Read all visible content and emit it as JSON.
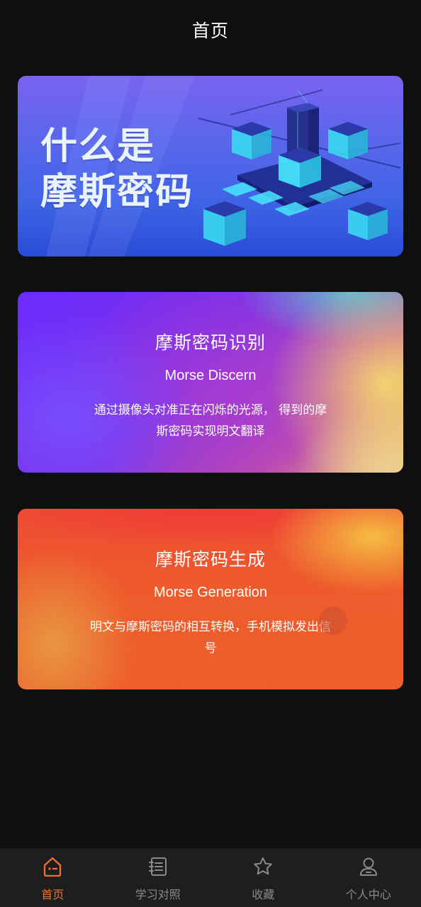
{
  "header": {
    "title": "首页"
  },
  "banner": {
    "line1": "什么是",
    "line2": "摩斯密码"
  },
  "cards": [
    {
      "title": "摩斯密码识别",
      "subtitle": "Morse Discern",
      "description": "通过摄像头对准正在闪烁的光源， 得到的摩斯密码实现明文翻译"
    },
    {
      "title": "摩斯密码生成",
      "subtitle": "Morse Generation",
      "description": "明文与摩斯密码的相互转换，手机模拟发出信号"
    }
  ],
  "tabbar": {
    "items": [
      {
        "label": "首页",
        "icon": "home-icon",
        "active": true
      },
      {
        "label": "学习对照",
        "icon": "notebook-icon",
        "active": false
      },
      {
        "label": "收藏",
        "icon": "star-icon",
        "active": false
      },
      {
        "label": "个人中心",
        "icon": "user-icon",
        "active": false
      }
    ]
  },
  "colors": {
    "background": "#0f0f0f",
    "tabbar_background": "#1e1e1e",
    "accent": "#f2702e",
    "inactive": "#8a8a8a"
  }
}
